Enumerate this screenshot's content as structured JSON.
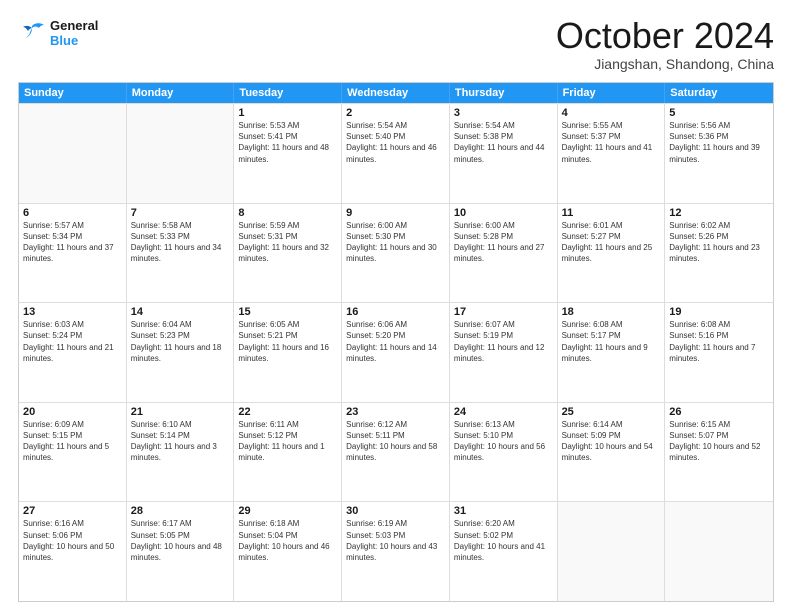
{
  "header": {
    "logo_line1": "General",
    "logo_line2": "Blue",
    "month": "October 2024",
    "location": "Jiangshan, Shandong, China"
  },
  "weekdays": [
    "Sunday",
    "Monday",
    "Tuesday",
    "Wednesday",
    "Thursday",
    "Friday",
    "Saturday"
  ],
  "weeks": [
    [
      {
        "day": "",
        "info": ""
      },
      {
        "day": "",
        "info": ""
      },
      {
        "day": "1",
        "info": "Sunrise: 5:53 AM\nSunset: 5:41 PM\nDaylight: 11 hours and 48 minutes."
      },
      {
        "day": "2",
        "info": "Sunrise: 5:54 AM\nSunset: 5:40 PM\nDaylight: 11 hours and 46 minutes."
      },
      {
        "day": "3",
        "info": "Sunrise: 5:54 AM\nSunset: 5:38 PM\nDaylight: 11 hours and 44 minutes."
      },
      {
        "day": "4",
        "info": "Sunrise: 5:55 AM\nSunset: 5:37 PM\nDaylight: 11 hours and 41 minutes."
      },
      {
        "day": "5",
        "info": "Sunrise: 5:56 AM\nSunset: 5:36 PM\nDaylight: 11 hours and 39 minutes."
      }
    ],
    [
      {
        "day": "6",
        "info": "Sunrise: 5:57 AM\nSunset: 5:34 PM\nDaylight: 11 hours and 37 minutes."
      },
      {
        "day": "7",
        "info": "Sunrise: 5:58 AM\nSunset: 5:33 PM\nDaylight: 11 hours and 34 minutes."
      },
      {
        "day": "8",
        "info": "Sunrise: 5:59 AM\nSunset: 5:31 PM\nDaylight: 11 hours and 32 minutes."
      },
      {
        "day": "9",
        "info": "Sunrise: 6:00 AM\nSunset: 5:30 PM\nDaylight: 11 hours and 30 minutes."
      },
      {
        "day": "10",
        "info": "Sunrise: 6:00 AM\nSunset: 5:28 PM\nDaylight: 11 hours and 27 minutes."
      },
      {
        "day": "11",
        "info": "Sunrise: 6:01 AM\nSunset: 5:27 PM\nDaylight: 11 hours and 25 minutes."
      },
      {
        "day": "12",
        "info": "Sunrise: 6:02 AM\nSunset: 5:26 PM\nDaylight: 11 hours and 23 minutes."
      }
    ],
    [
      {
        "day": "13",
        "info": "Sunrise: 6:03 AM\nSunset: 5:24 PM\nDaylight: 11 hours and 21 minutes."
      },
      {
        "day": "14",
        "info": "Sunrise: 6:04 AM\nSunset: 5:23 PM\nDaylight: 11 hours and 18 minutes."
      },
      {
        "day": "15",
        "info": "Sunrise: 6:05 AM\nSunset: 5:21 PM\nDaylight: 11 hours and 16 minutes."
      },
      {
        "day": "16",
        "info": "Sunrise: 6:06 AM\nSunset: 5:20 PM\nDaylight: 11 hours and 14 minutes."
      },
      {
        "day": "17",
        "info": "Sunrise: 6:07 AM\nSunset: 5:19 PM\nDaylight: 11 hours and 12 minutes."
      },
      {
        "day": "18",
        "info": "Sunrise: 6:08 AM\nSunset: 5:17 PM\nDaylight: 11 hours and 9 minutes."
      },
      {
        "day": "19",
        "info": "Sunrise: 6:08 AM\nSunset: 5:16 PM\nDaylight: 11 hours and 7 minutes."
      }
    ],
    [
      {
        "day": "20",
        "info": "Sunrise: 6:09 AM\nSunset: 5:15 PM\nDaylight: 11 hours and 5 minutes."
      },
      {
        "day": "21",
        "info": "Sunrise: 6:10 AM\nSunset: 5:14 PM\nDaylight: 11 hours and 3 minutes."
      },
      {
        "day": "22",
        "info": "Sunrise: 6:11 AM\nSunset: 5:12 PM\nDaylight: 11 hours and 1 minute."
      },
      {
        "day": "23",
        "info": "Sunrise: 6:12 AM\nSunset: 5:11 PM\nDaylight: 10 hours and 58 minutes."
      },
      {
        "day": "24",
        "info": "Sunrise: 6:13 AM\nSunset: 5:10 PM\nDaylight: 10 hours and 56 minutes."
      },
      {
        "day": "25",
        "info": "Sunrise: 6:14 AM\nSunset: 5:09 PM\nDaylight: 10 hours and 54 minutes."
      },
      {
        "day": "26",
        "info": "Sunrise: 6:15 AM\nSunset: 5:07 PM\nDaylight: 10 hours and 52 minutes."
      }
    ],
    [
      {
        "day": "27",
        "info": "Sunrise: 6:16 AM\nSunset: 5:06 PM\nDaylight: 10 hours and 50 minutes."
      },
      {
        "day": "28",
        "info": "Sunrise: 6:17 AM\nSunset: 5:05 PM\nDaylight: 10 hours and 48 minutes."
      },
      {
        "day": "29",
        "info": "Sunrise: 6:18 AM\nSunset: 5:04 PM\nDaylight: 10 hours and 46 minutes."
      },
      {
        "day": "30",
        "info": "Sunrise: 6:19 AM\nSunset: 5:03 PM\nDaylight: 10 hours and 43 minutes."
      },
      {
        "day": "31",
        "info": "Sunrise: 6:20 AM\nSunset: 5:02 PM\nDaylight: 10 hours and 41 minutes."
      },
      {
        "day": "",
        "info": ""
      },
      {
        "day": "",
        "info": ""
      }
    ]
  ]
}
